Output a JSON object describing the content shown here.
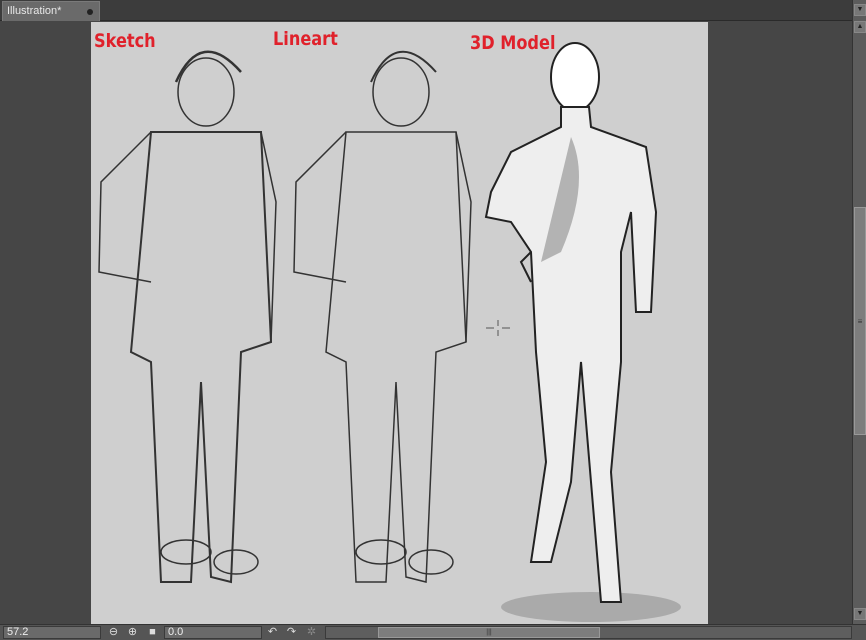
{
  "document_tab": {
    "title": "Illustration*",
    "modified_indicator": "dot-icon"
  },
  "canvas": {
    "labels": {
      "sketch": "Sketch",
      "lineart": "Lineart",
      "model": "3D Model"
    },
    "label_color": "#e0212b",
    "paper_color": "#cfcfcf"
  },
  "statusbar": {
    "zoom_value": "57.2",
    "rotation_value": "0.0",
    "icons": [
      "zoom-out-icon",
      "zoom-in-icon",
      "fit-icon",
      "rotate-left-icon",
      "rotate-right-icon",
      "reset-rotation-icon"
    ]
  }
}
